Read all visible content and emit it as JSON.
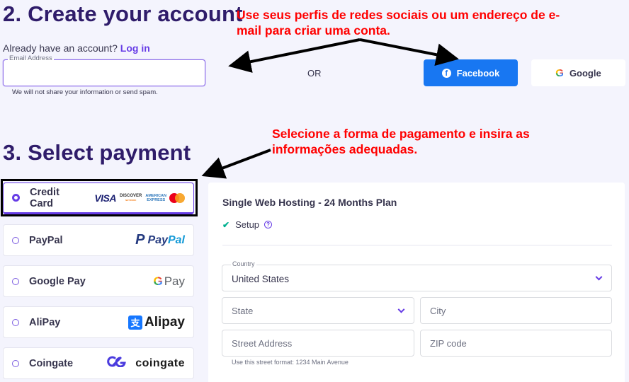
{
  "create_account": {
    "heading": "2. Create your account",
    "already_text": "Already have an account? ",
    "login_link": "Log in",
    "email": {
      "legend": "Email Address",
      "value": "",
      "placeholder": "",
      "help": "We will not share your information or send spam."
    },
    "or_text": "OR",
    "facebook_button": {
      "label": "Facebook",
      "icon": "facebook-icon",
      "color": "#1877f2"
    },
    "google_button": {
      "label": "Google",
      "icon": "google-icon"
    }
  },
  "payment": {
    "heading": "3. Select payment",
    "methods": [
      {
        "label": "Credit Card",
        "selected": true,
        "logos": {
          "visa": "VISA",
          "discover": "DISCOVER",
          "discover_sub": "NETWORK",
          "amex_1": "AMERICAN",
          "amex_2": "EXPRESS"
        }
      },
      {
        "label": "PayPal",
        "selected": false,
        "logo_text_1": "Pay",
        "logo_text_2": "Pal",
        "logo_mark": "P"
      },
      {
        "label": "Google Pay",
        "selected": false,
        "logo_g": "G",
        "logo_text": "Pay"
      },
      {
        "label": "AliPay",
        "selected": false,
        "logo_mark": "支",
        "logo_text": "Alipay"
      },
      {
        "label": "Coingate",
        "selected": false,
        "logo_mark": "CG",
        "logo_text": "coingate"
      }
    ]
  },
  "order": {
    "plan_title": "Single Web Hosting - 24 Months Plan",
    "setup_label": "Setup",
    "help_glyph": "?",
    "country": {
      "legend": "Country",
      "value": "United States"
    },
    "state": {
      "placeholder": "State"
    },
    "city": {
      "placeholder": "City"
    },
    "street": {
      "placeholder": "Street Address",
      "help": "Use this street format: 1234 Main Avenue"
    },
    "zip": {
      "placeholder": "ZIP code"
    }
  },
  "annotations": {
    "social_note": "Use seus perfis de redes sociais ou um endereço de e-mail para criar uma conta.",
    "payment_note": "Selecione a forma de pagamento e insira as informações adequadas.",
    "color": "#ff0000"
  },
  "colors": {
    "heading": "#2f1c6a",
    "accent": "#673de6",
    "background": "#f4f4fd",
    "check": "#00b090"
  }
}
